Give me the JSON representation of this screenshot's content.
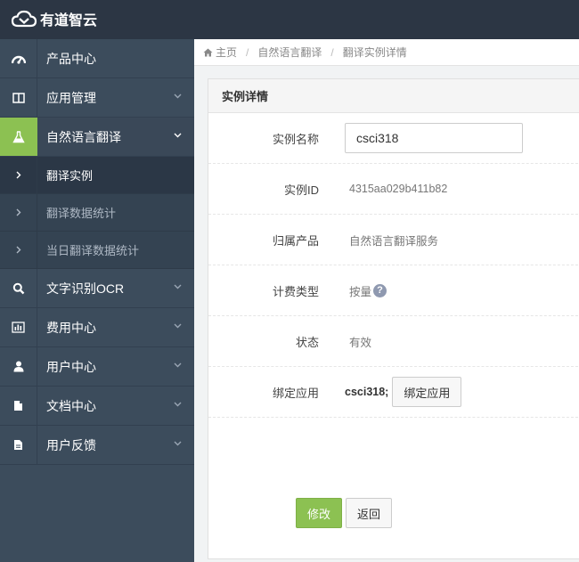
{
  "app": {
    "logo_text": "有道智云"
  },
  "sidebar": {
    "items": [
      {
        "label": "产品中心",
        "icon": "dashboard-icon",
        "chevron": false
      },
      {
        "label": "应用管理",
        "icon": "columns-icon",
        "chevron": true
      },
      {
        "label": "自然语言翻译",
        "icon": "flask-icon",
        "chevron": true,
        "active": true
      },
      {
        "label": "文字识别OCR",
        "icon": "search-icon",
        "chevron": true
      },
      {
        "label": "费用中心",
        "icon": "bar-chart-icon",
        "chevron": true
      },
      {
        "label": "用户中心",
        "icon": "user-icon",
        "chevron": true
      },
      {
        "label": "文档中心",
        "icon": "file-icon",
        "chevron": true
      },
      {
        "label": "用户反馈",
        "icon": "file-text-icon",
        "chevron": true
      }
    ],
    "subitems": [
      {
        "label": "翻译实例",
        "current": true
      },
      {
        "label": "翻译数据统计"
      },
      {
        "label": "当日翻译数据统计"
      }
    ]
  },
  "breadcrumb": {
    "home": "主页",
    "level1": "自然语言翻译",
    "level2": "翻译实例详情"
  },
  "panel": {
    "title": "实例详情"
  },
  "fields": {
    "name_label": "实例名称",
    "name_value": "csci318",
    "id_label": "实例ID",
    "id_value": "4315aa029b411b82",
    "product_label": "归属产品",
    "product_value": "自然语言翻译服务",
    "billing_label": "计费类型",
    "billing_value": "按量",
    "billing_help": "?",
    "status_label": "状态",
    "status_value": "有效",
    "bind_label": "绑定应用",
    "bind_value": "csci318;",
    "bind_button": "绑定应用"
  },
  "actions": {
    "modify": "修改",
    "back": "返回"
  },
  "colors": {
    "topbar": "#2c3644",
    "sidebar": "#3c4c5c",
    "accent": "#8cc152",
    "help": "#8f99b0"
  }
}
